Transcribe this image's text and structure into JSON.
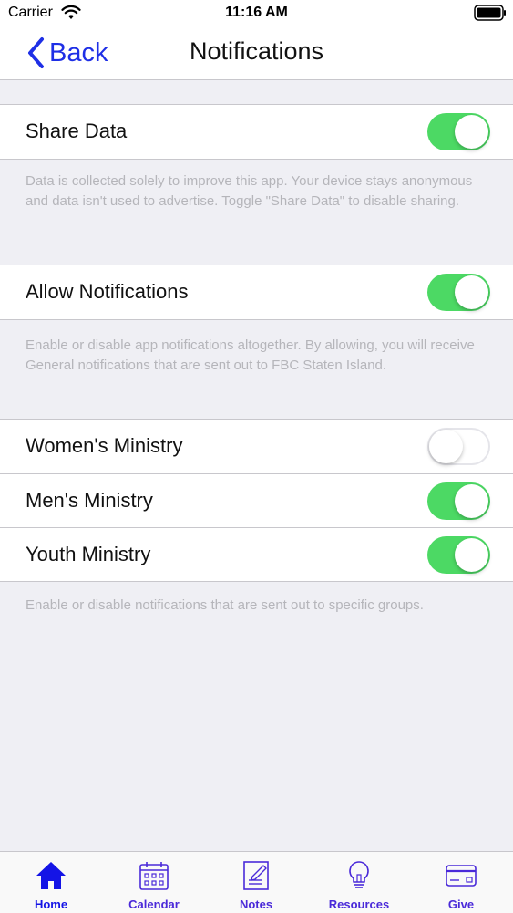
{
  "status_bar": {
    "carrier": "Carrier",
    "time": "11:16 AM"
  },
  "nav": {
    "back_label": "Back",
    "title": "Notifications"
  },
  "sections": {
    "share_data": {
      "label": "Share Data",
      "enabled": true,
      "footer": "Data is collected solely to improve this app. Your device stays anonymous and data isn't used to advertise. Toggle \"Share Data\" to disable sharing."
    },
    "allow_notifications": {
      "label": "Allow Notifications",
      "enabled": true,
      "footer": "Enable or disable app notifications altogether. By allowing, you will receive General notifications that are sent out to FBC Staten Island."
    },
    "groups": {
      "items": [
        {
          "label": "Women's Ministry",
          "enabled": false
        },
        {
          "label": "Men's Ministry",
          "enabled": true
        },
        {
          "label": "Youth Ministry",
          "enabled": true
        }
      ],
      "footer": "Enable or disable notifications that are sent out to specific groups."
    }
  },
  "tab_bar": {
    "tabs": [
      {
        "label": "Home",
        "icon": "home-icon",
        "active": true
      },
      {
        "label": "Calendar",
        "icon": "calendar-icon",
        "active": false
      },
      {
        "label": "Notes",
        "icon": "notes-icon",
        "active": false
      },
      {
        "label": "Resources",
        "icon": "lightbulb-icon",
        "active": false
      },
      {
        "label": "Give",
        "icon": "credit-card-icon",
        "active": false
      }
    ]
  },
  "colors": {
    "accent": "#1e2fe6",
    "toggle_on": "#4cd964",
    "tab_label": "#4a2ad9",
    "background": "#efeff4",
    "footer_text": "#b5b5ba"
  }
}
